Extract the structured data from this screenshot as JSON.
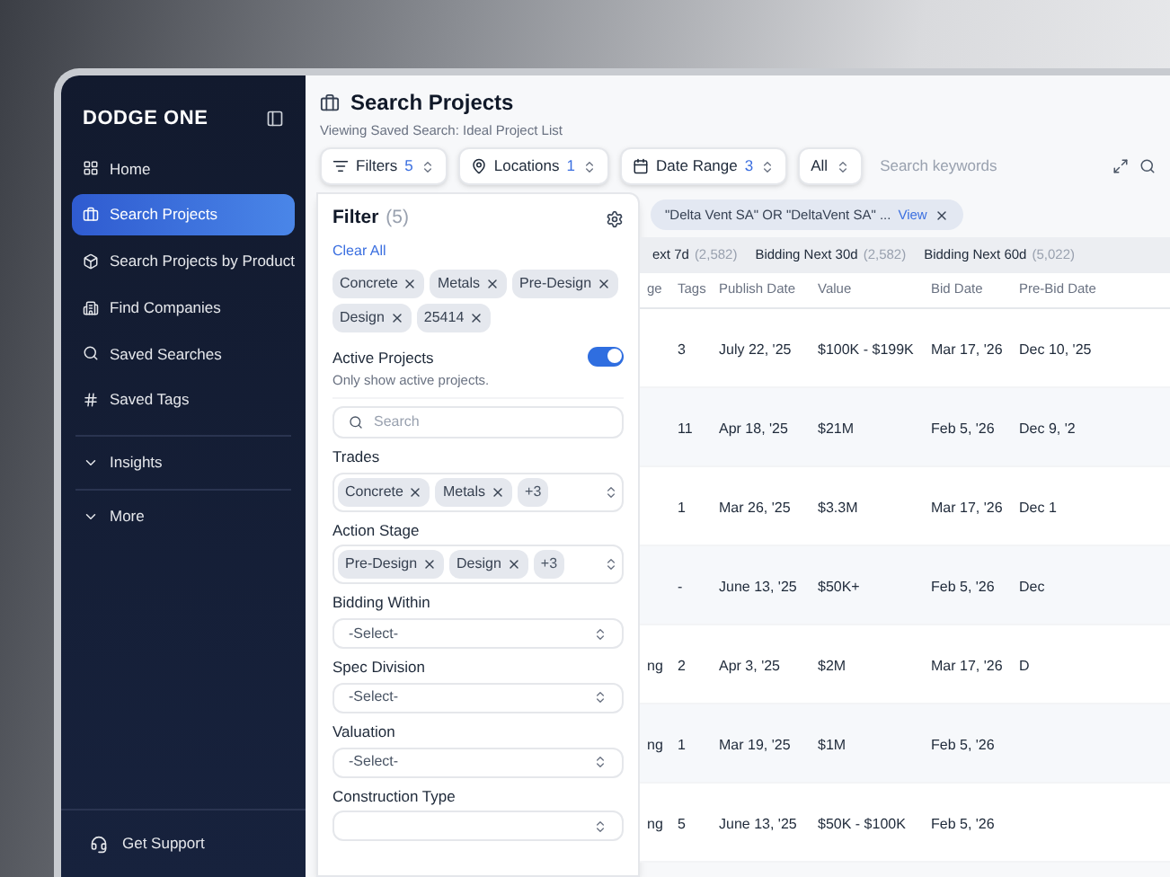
{
  "sidebar": {
    "logo": "DODGE ONE",
    "items": [
      {
        "label": "Home",
        "selected": false
      },
      {
        "label": "Search Projects",
        "selected": true
      },
      {
        "label": "Search Projects by Product",
        "selected": false
      },
      {
        "label": "Find Companies",
        "selected": false
      },
      {
        "label": "Saved Searches",
        "selected": false
      },
      {
        "label": "Saved Tags",
        "selected": false
      }
    ],
    "sections": [
      "Insights",
      "More"
    ],
    "support": "Get Support"
  },
  "header": {
    "title": "Search Projects",
    "subtitle": "Viewing Saved Search: Ideal Project List"
  },
  "toolbar": {
    "selectors": [
      {
        "label": "Filters",
        "count": "5"
      },
      {
        "label": "Locations",
        "count": "1"
      },
      {
        "label": "Date Range",
        "count": "3"
      },
      {
        "label": "All"
      }
    ],
    "search": {
      "placeholder": "Search keywords"
    }
  },
  "active_query": {
    "text": "\"Delta Vent SA\" OR \"DeltaVent SA\" ...",
    "link": "View"
  },
  "filter_panel": {
    "title": "Filter",
    "count": "(5)",
    "clear": "Clear All",
    "chips": [
      "Concrete",
      "Metals",
      "Pre-Design",
      "Design",
      "25414"
    ],
    "active_projects": {
      "label": "Active Projects",
      "hint": "Only show active projects.",
      "on": true
    },
    "search": {
      "placeholder": "Search"
    },
    "fields": [
      {
        "kind": "tags",
        "label": "Trades",
        "tags": [
          "Concrete",
          "Metals"
        ],
        "more": "+3"
      },
      {
        "kind": "tags",
        "label": "Action Stage",
        "tags": [
          "Pre-Design",
          "Design"
        ],
        "more": "+3"
      },
      {
        "kind": "select",
        "label": "Bidding Within",
        "placeholder": "-Select-"
      },
      {
        "kind": "select",
        "label": "Spec Division",
        "placeholder": "-Select-"
      },
      {
        "kind": "select",
        "label": "Valuation",
        "placeholder": "-Select-"
      },
      {
        "kind": "select",
        "label": "Construction Type"
      }
    ]
  },
  "tabs": [
    {
      "label": "ext 7d",
      "count": "(2,582)",
      "selected": false
    },
    {
      "label": "Bidding Next 30d",
      "count": "(2,582)",
      "selected": false
    },
    {
      "label": "Bidding Next 60d",
      "count": "(5,022)",
      "selected": false
    }
  ],
  "table": {
    "columns": [
      "ge",
      "Tags",
      "Publish Date",
      "Value",
      "Bid Date",
      "Pre-Bid Date"
    ],
    "rows": [
      [
        null,
        "3",
        "July 22, '25",
        "$100K - $199K",
        "Mar 17, '26",
        "Dec 10, '25"
      ],
      [
        null,
        "11",
        "Apr 18, '25",
        "$21M",
        "Feb 5, '26",
        "Dec 9, '2"
      ],
      [
        null,
        "1",
        "Mar 26, '25",
        "$3.3M",
        "Mar 17, '26",
        "Dec 1"
      ],
      [
        null,
        "-",
        "June 13, '25",
        "$50K+",
        "Feb 5, '26",
        "Dec"
      ],
      [
        "ng",
        "2",
        "Apr 3, '25",
        "$2M",
        "Mar 17, '26",
        "D"
      ],
      [
        "ng",
        "1",
        "Mar 19, '25",
        "$1M",
        "Feb 5, '26",
        null
      ],
      [
        "ng",
        "5",
        "June 13, '25",
        "$50K - $100K",
        "Feb 5, '26",
        null
      ]
    ]
  }
}
